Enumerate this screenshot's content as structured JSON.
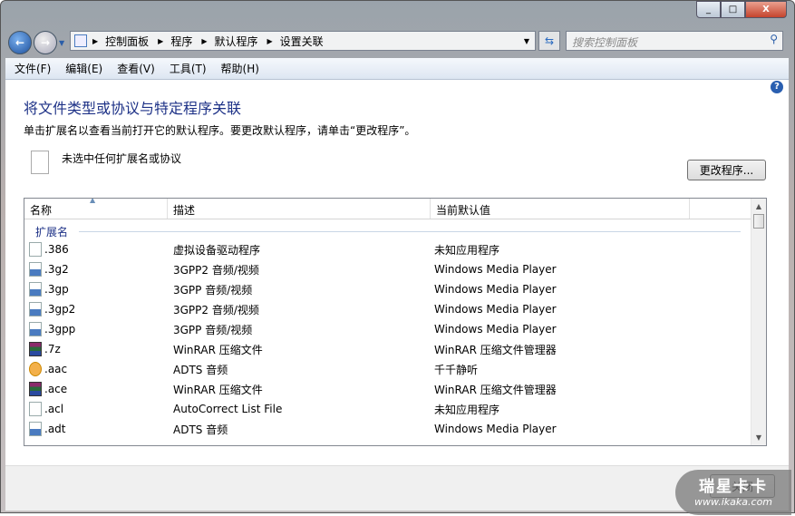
{
  "window": {
    "min": "_",
    "max": "□",
    "close": "X"
  },
  "nav": {
    "back": "←",
    "forward": "→"
  },
  "address": {
    "crumbs": [
      "控制面板",
      "程序",
      "默认程序",
      "设置关联"
    ]
  },
  "search": {
    "placeholder": "搜索控制面板"
  },
  "menu": [
    "文件(F)",
    "编辑(E)",
    "查看(V)",
    "工具(T)",
    "帮助(H)"
  ],
  "main": {
    "title": "将文件类型或协议与特定程序关联",
    "subtitle": "单击扩展名以查看当前打开它的默认程序。要更改默认程序，请单击“更改程序”。",
    "selection": "未选中任何扩展名或协议",
    "change_button": "更改程序...",
    "columns": [
      "名称",
      "描述",
      "当前默认值"
    ],
    "group": "扩展名",
    "rows": [
      {
        "icon": "blank",
        "name": ".386",
        "desc": "虚拟设备驱动程序",
        "default": "未知应用程序"
      },
      {
        "icon": "wmp",
        "name": ".3g2",
        "desc": "3GPP2 音频/视频",
        "default": "Windows Media Player"
      },
      {
        "icon": "wmp",
        "name": ".3gp",
        "desc": "3GPP 音频/视频",
        "default": "Windows Media Player"
      },
      {
        "icon": "wmp",
        "name": ".3gp2",
        "desc": "3GPP2 音频/视频",
        "default": "Windows Media Player"
      },
      {
        "icon": "wmp",
        "name": ".3gpp",
        "desc": "3GPP 音频/视频",
        "default": "Windows Media Player"
      },
      {
        "icon": "rar",
        "name": ".7z",
        "desc": "WinRAR 压缩文件",
        "default": "WinRAR 压缩文件管理器"
      },
      {
        "icon": "aac",
        "name": ".aac",
        "desc": "ADTS 音频",
        "default": "千千静听"
      },
      {
        "icon": "rar",
        "name": ".ace",
        "desc": "WinRAR 压缩文件",
        "default": "WinRAR 压缩文件管理器"
      },
      {
        "icon": "blank",
        "name": ".acl",
        "desc": "AutoCorrect List File",
        "default": "未知应用程序"
      },
      {
        "icon": "wmp",
        "name": ".adt",
        "desc": "ADTS 音频",
        "default": "Windows Media Player"
      }
    ]
  },
  "footer": {
    "close_button": "关闭"
  },
  "watermark": {
    "brand": "瑞星卡卡",
    "url": "www.ikaka.com"
  }
}
